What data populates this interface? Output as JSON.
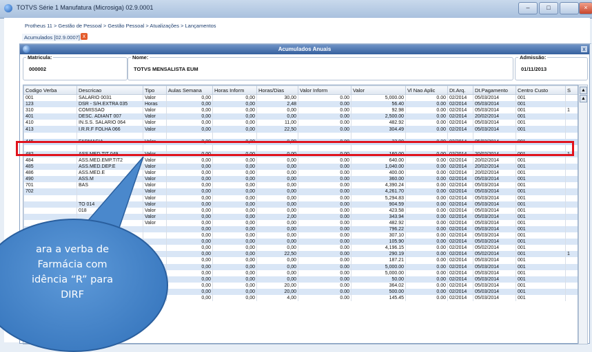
{
  "window": {
    "title": "TOTVS Série 1 Manufatura (Microsiga) 02.9.0001",
    "min": "–",
    "max": "□",
    "close": "×"
  },
  "breadcrumb": "Protheus 11 > Gestão de Pessoal > Gestão Pessoal > Atualizações > Lançamentos",
  "tab": {
    "label": "Acumulados [02.9.0007]",
    "close": "x"
  },
  "panel": {
    "title": "Acumulados Anuais",
    "close": "x"
  },
  "fields": {
    "matricula": {
      "label": "Matricula:",
      "value": "000002"
    },
    "nome": {
      "label": "Nome:",
      "value": "TOTVS  MENSALISTA EUM"
    },
    "admissao": {
      "label": "Admissão:",
      "value": "01/11/2013"
    }
  },
  "grid": {
    "columns": [
      "Codigo Verba",
      "Descricao",
      "Tipo",
      "Aulas Semana",
      "Horas Inform",
      "Horas/Dias",
      "Valor Inform",
      "Valor",
      "Vl Nao Aplic",
      "Dt.Arq.",
      "Dt.Pagamento",
      "Centro Custo",
      "S"
    ],
    "rows": [
      [
        "001",
        "SALARIO 0031",
        "Valor",
        "0,00",
        "0,00",
        "30,00",
        "0.00",
        "5,000.00",
        "0.00",
        "02/2014",
        "05/03/2014",
        "001",
        ""
      ],
      [
        "123",
        "DSR - S/H.EXTRA 035",
        "Horas",
        "0,00",
        "0,00",
        "2,48",
        "0.00",
        "56.40",
        "0.00",
        "02/2014",
        "05/03/2014",
        "001",
        ""
      ],
      [
        "310",
        "COMISSAO",
        "Valor",
        "0,00",
        "0,00",
        "0,00",
        "0.00",
        "92.98",
        "0.00",
        "02/2014",
        "05/03/2014",
        "001",
        "1"
      ],
      [
        "401",
        "DESC. ADIANT 007",
        "Valor",
        "0,00",
        "0,00",
        "0,00",
        "0.00",
        "2,500.00",
        "0.00",
        "02/2014",
        "20/02/2014",
        "001",
        ""
      ],
      [
        "410",
        "IN.S.S. SALARIO 064",
        "Valor",
        "0,00",
        "0,00",
        "11,00",
        "0.00",
        "482.92",
        "0.00",
        "02/2014",
        "05/03/2014",
        "001",
        ""
      ],
      [
        "413",
        "I.R.R.F FOLHA 066",
        "Valor",
        "0,00",
        "0,00",
        "22,50",
        "0.00",
        "304.49",
        "0.00",
        "02/2014",
        "05/03/2014",
        "001",
        ""
      ],
      [
        "",
        "",
        "",
        "",
        "",
        "",
        "",
        "",
        "",
        "",
        "",
        "",
        ""
      ],
      [
        "445",
        "FARMACIA",
        "Valor",
        "0,00",
        "0,00",
        "0,00",
        "0.00",
        "22.90",
        "0.00",
        "02/2014",
        "05/03/2014",
        "001",
        ""
      ],
      [
        "",
        "",
        "",
        "",
        "",
        "",
        "",
        "",
        "",
        "",
        "",
        "",
        ""
      ],
      [
        "482",
        "ASS.MED.TIT 049",
        "Valor",
        "0,00",
        "0,00",
        "0,00",
        "0.00",
        "160.00",
        "0.00",
        "02/2014",
        "20/02/2014",
        "001",
        "1"
      ],
      [
        "484",
        "ASS.MED.EMP.TIT2",
        "Valor",
        "0,00",
        "0,00",
        "0,00",
        "0.00",
        "640.00",
        "0.00",
        "02/2014",
        "20/02/2014",
        "001",
        ""
      ],
      [
        "485",
        "ASS.MED.DEP.E",
        "Valor",
        "0,00",
        "0,00",
        "0,00",
        "0.00",
        "1,040.00",
        "0.00",
        "02/2014",
        "20/02/2014",
        "001",
        ""
      ],
      [
        "486",
        "ASS.MED.E",
        "Valor",
        "0,00",
        "0,00",
        "0,00",
        "0.00",
        "400.00",
        "0.00",
        "02/2014",
        "20/02/2014",
        "001",
        ""
      ],
      [
        "490",
        "ASS.M",
        "Valor",
        "0,00",
        "0,00",
        "0,00",
        "0.00",
        "360.00",
        "0.00",
        "02/2014",
        "05/03/2014",
        "001",
        ""
      ],
      [
        "701",
        "BAS",
        "Valor",
        "0,00",
        "0,00",
        "0,00",
        "0.00",
        "4,390.24",
        "0.00",
        "02/2014",
        "05/03/2014",
        "001",
        ""
      ],
      [
        "702",
        "",
        "Valor",
        "0,00",
        "0,00",
        "0,00",
        "0.00",
        "4,261.70",
        "0.00",
        "02/2014",
        "05/03/2014",
        "001",
        ""
      ],
      [
        "",
        "",
        "Valor",
        "0,00",
        "0,00",
        "0,00",
        "0.00",
        "5,294.83",
        "0.00",
        "02/2014",
        "05/03/2014",
        "001",
        ""
      ],
      [
        "",
        "TO 014",
        "Valor",
        "0,00",
        "0,00",
        "0,00",
        "0.00",
        "904.59",
        "0.00",
        "02/2014",
        "05/03/2014",
        "001",
        ""
      ],
      [
        "",
        "018",
        "Valor",
        "0,00",
        "0,00",
        "0,00",
        "0.00",
        "423.58",
        "0.00",
        "02/2014",
        "05/03/2014",
        "001",
        ""
      ],
      [
        "",
        "",
        "Valor",
        "0,00",
        "0,00",
        "2,00",
        "0.00",
        "343.94",
        "0.00",
        "02/2014",
        "05/03/2014",
        "001",
        ""
      ],
      [
        "",
        "",
        "Valor",
        "0,00",
        "0,00",
        "0,00",
        "0.00",
        "482.92",
        "0.00",
        "02/2014",
        "05/03/2014",
        "001",
        ""
      ],
      [
        "",
        "",
        "",
        "0,00",
        "0,00",
        "0,00",
        "0.00",
        "796.22",
        "0.00",
        "02/2014",
        "05/03/2014",
        "001",
        ""
      ],
      [
        "",
        "",
        "",
        "0,00",
        "0,00",
        "0,00",
        "0.00",
        "307.10",
        "0.00",
        "02/2014",
        "05/03/2014",
        "001",
        ""
      ],
      [
        "",
        "",
        "",
        "0,00",
        "0,00",
        "0,00",
        "0.00",
        "105.90",
        "0.00",
        "02/2014",
        "05/03/2014",
        "001",
        ""
      ],
      [
        "",
        "",
        "",
        "0,00",
        "0,00",
        "0,00",
        "0.00",
        "4,196.15",
        "0.00",
        "02/2014",
        "05/02/2014",
        "001",
        ""
      ],
      [
        "",
        "",
        "",
        "0,00",
        "0,00",
        "22,50",
        "0.00",
        "290.19",
        "0.00",
        "02/2014",
        "05/02/2014",
        "001",
        "1"
      ],
      [
        "",
        "",
        "",
        "0,00",
        "0,00",
        "0,00",
        "0.00",
        "187.21",
        "0.00",
        "02/2014",
        "05/03/2014",
        "001",
        ""
      ],
      [
        "",
        "",
        "",
        "0,00",
        "0,00",
        "0,00",
        "0.00",
        "5,000.00",
        "0.00",
        "02/2014",
        "05/03/2014",
        "001",
        ""
      ],
      [
        "",
        "",
        "alor",
        "0,00",
        "0,00",
        "0,00",
        "0.00",
        "5,000.00",
        "0.00",
        "02/2014",
        "05/03/2014",
        "001",
        ""
      ],
      [
        "",
        "",
        "alor",
        "0,00",
        "0,00",
        "0,00",
        "0.00",
        "50.00",
        "0.00",
        "02/2014",
        "05/03/2014",
        "001",
        ""
      ],
      [
        "",
        "02",
        "Valor",
        "0,00",
        "0,00",
        "20,00",
        "0.00",
        "364.02",
        "0.00",
        "02/2014",
        "05/03/2014",
        "001",
        ""
      ],
      [
        "",
        "",
        "Valor",
        "0,00",
        "0,00",
        "20,00",
        "0.00",
        "500.00",
        "0.00",
        "02/2014",
        "05/03/2014",
        "001",
        ""
      ],
      [
        "",
        "TRA 60%",
        "Horas",
        "0,00",
        "0,00",
        "4,00",
        "0.00",
        "145.45",
        "0.00",
        "02/2014",
        "05/03/2014",
        "001",
        ""
      ]
    ]
  },
  "callout_text": [
    "ara a verba de",
    "Farmácia com",
    "idência “R” para",
    "DIRF"
  ],
  "colors": {
    "highlight": "#e0121c",
    "callout": "#3d7fc6",
    "header": "#35609e",
    "row_alt": "#d9e6f6"
  }
}
